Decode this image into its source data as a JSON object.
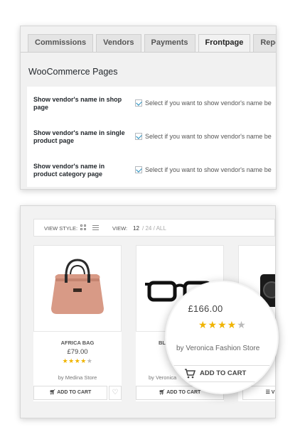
{
  "settings_panel": {
    "tabs": [
      {
        "label": "Commissions",
        "active": false
      },
      {
        "label": "Vendors",
        "active": false
      },
      {
        "label": "Payments",
        "active": false
      },
      {
        "label": "Frontpage",
        "active": true
      },
      {
        "label": "Reports",
        "active": false
      }
    ],
    "section_title": "WooCommerce Pages",
    "rows": [
      {
        "label": "Show vendor's name in shop page",
        "checked": true,
        "description": "Select if you want to show vendor's name be"
      },
      {
        "label": "Show vendor's name in single product page",
        "checked": true,
        "description": "Select if you want to show vendor's name be"
      },
      {
        "label": "Show vendor's name in product category page",
        "checked": true,
        "description": "Select if you want to show vendor's name be"
      }
    ]
  },
  "shop_panel": {
    "view_style_label": "VIEW STYLE:",
    "view_label": "VIEW:",
    "view_options": [
      "12",
      "/ 24 / ALL"
    ],
    "products": [
      {
        "name": "AFRICA BAG",
        "price": "£79.00",
        "rating": 4,
        "store": "by Medina Store",
        "cart_label": "ADD TO CART"
      },
      {
        "name": "BLA",
        "price": "£",
        "rating": 4,
        "store": "by Veronica",
        "cart_label": "ADD TO CART"
      },
      {
        "name": "",
        "price": "",
        "rating": 0,
        "store": "",
        "cart_label": "VI"
      }
    ]
  },
  "magnifier": {
    "price": "£166.00",
    "rating": 4,
    "store": "by Veronica Fashion Store",
    "cart_label": "ADD TO CART"
  },
  "colors": {
    "star": "#f0b400",
    "checkbox": "#1e8cbe",
    "bag": "#d89a86"
  }
}
